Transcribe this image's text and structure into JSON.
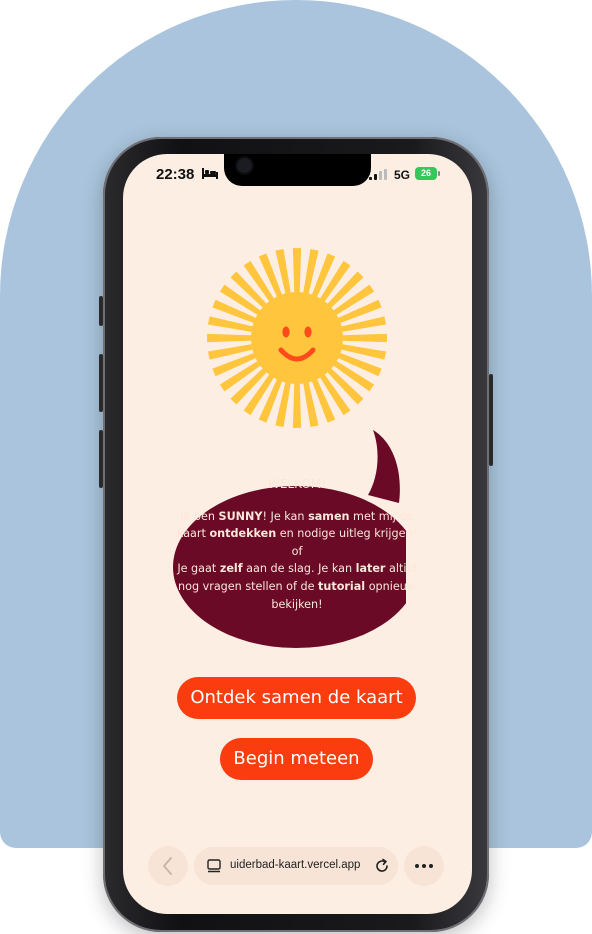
{
  "status_bar": {
    "time": "22:38",
    "bed_icon": "bed-icon",
    "network": "5G",
    "battery": "26"
  },
  "mascot": {
    "icon": "smiling-sun-icon",
    "colors": {
      "rays": "#ffc53d",
      "face": "#ff4a1c"
    }
  },
  "speech_bubble": {
    "title": "WELKOM!",
    "line1_pre": "Ik ben ",
    "line1_b1": "SUNNY",
    "line1_mid": "! Je kan ",
    "line1_b2": "samen",
    "line1_post": " met mij de",
    "line2_pre": "kaart ",
    "line2_b": "ontdekken",
    "line2_post": " en nodige uitleg krijgen!",
    "line3": "of",
    "line4_pre": "Je gaat ",
    "line4_b1": "zelf",
    "line4_mid": " aan de slag. Je kan ",
    "line4_b2": "later",
    "line4_post": " altijd",
    "line5_pre": "nog vragen stellen of de ",
    "line5_b": "tutorial",
    "line5_post": " opnieuw",
    "line6": "bekijken!",
    "color": "#6a0a26"
  },
  "buttons": {
    "together": "Ontdek samen de kaart",
    "start": "Begin meteen",
    "color": "#fa3c0f"
  },
  "browser": {
    "url": "uiderbad-kaart.vercel.app",
    "back_icon": "chevron-left-icon",
    "tabs_icon": "tabs-icon",
    "reload_icon": "reload-icon",
    "more_icon": "more-icon"
  },
  "background_color": "#a9c4dc"
}
